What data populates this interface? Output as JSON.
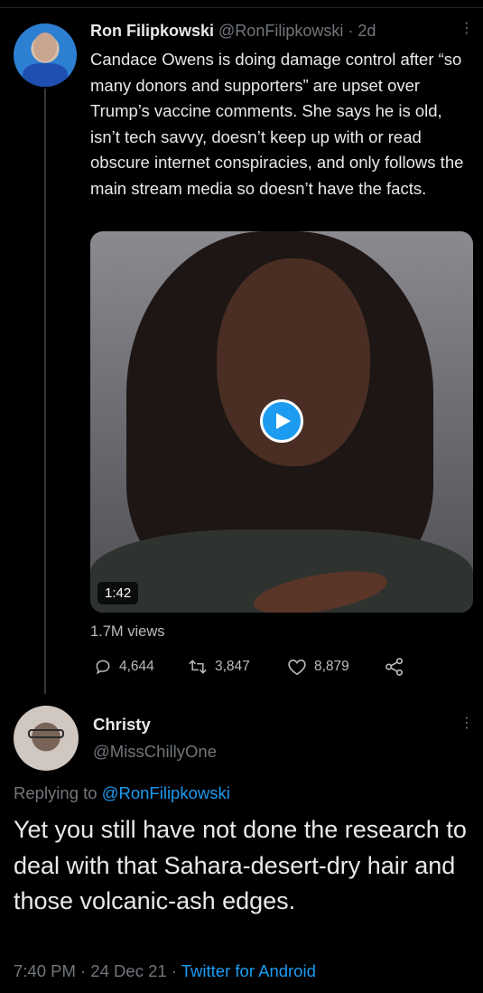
{
  "parent_tweet": {
    "avatar_icon": "profile-photo-icon",
    "name": "Ron Filipkowski",
    "handle_time": "@RonFilipkowski · 2d",
    "text": "Candace Owens is doing damage control after “so many donors and supporters” are upset over Trump’s vaccine comments. She says he is old, isn’t tech savvy, doesn’t keep up with or read obscure internet conspiracies, and only follows the main stream media so doesn’t have the facts.",
    "video": {
      "duration": "1:42",
      "play_icon": "play-icon"
    },
    "views": "1.7M views",
    "actions": {
      "replies": "4,644",
      "retweets": "3,847",
      "likes": "8,879"
    }
  },
  "reply_tweet": {
    "avatar_icon": "profile-photo-icon",
    "name": "Christy",
    "handle": "@MissChillyOne",
    "replying_prefix": "Replying to ",
    "replying_mention": "@RonFilipkowski",
    "text": "Yet you still have not done the research to deal with that Sahara-desert-dry hair and those volcanic-ash edges.",
    "timestamp": "7:40 PM · 24 Dec 21 · ",
    "source": "Twitter for Android"
  },
  "colors": {
    "background": "#000000",
    "accent": "#1d9bf0",
    "secondary_text": "#71767b"
  }
}
